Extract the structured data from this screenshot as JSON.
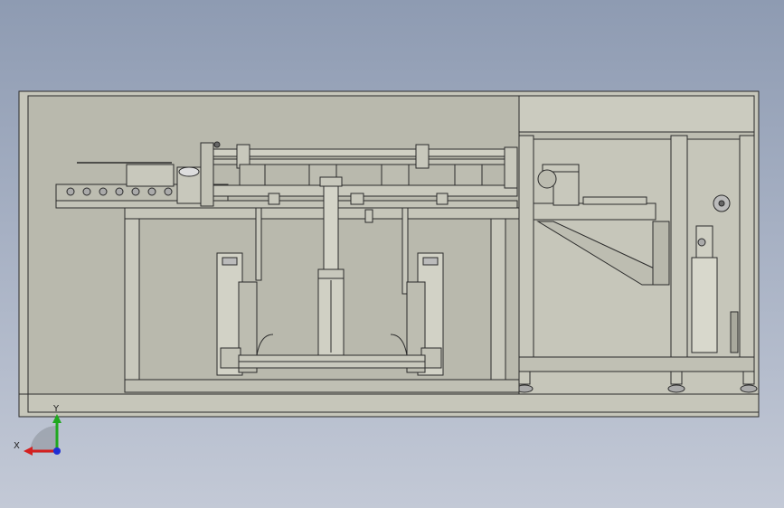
{
  "viewport": {
    "background_top": "#8e9bb2",
    "background_bottom": "#c3c9d6",
    "model_fill": "#c8c8bc",
    "model_edge": "#2b2b2b"
  },
  "triad": {
    "x_label": "X",
    "y_label": "Y",
    "x_color": "#d42020",
    "y_color": "#1fa81f",
    "z_color": "#1f2fd4"
  }
}
